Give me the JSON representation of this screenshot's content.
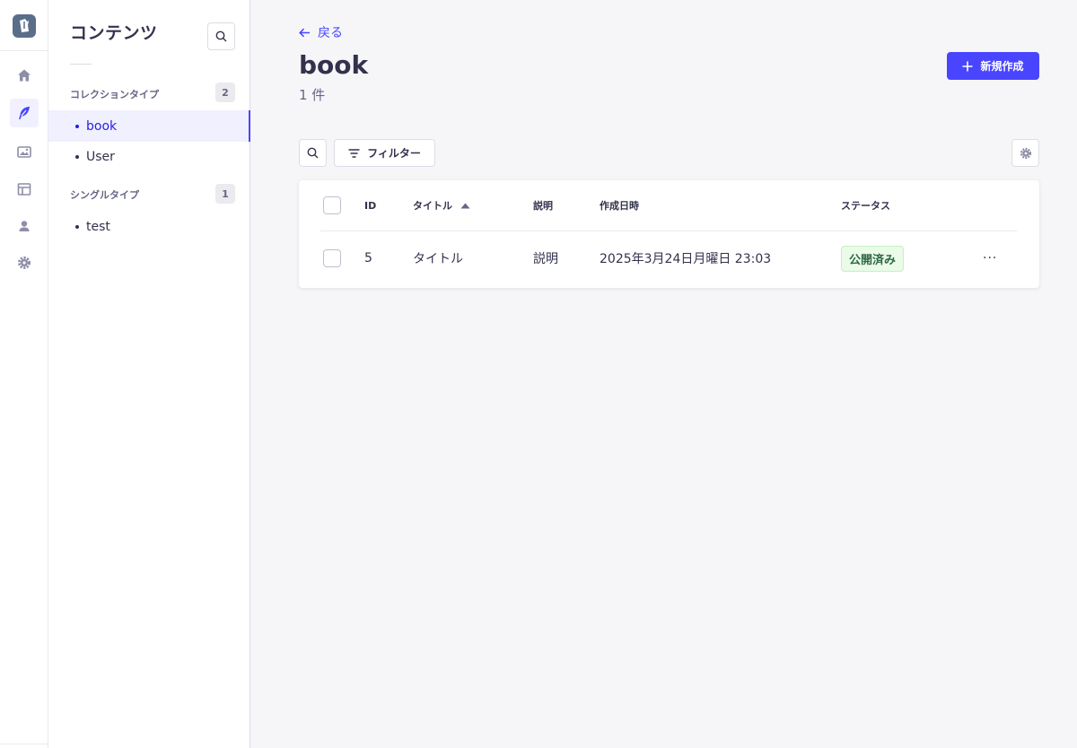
{
  "rail": {
    "items": [
      {
        "name": "home-icon"
      },
      {
        "name": "feather-icon",
        "active": true
      },
      {
        "name": "media-library-icon"
      },
      {
        "name": "layout-icon"
      },
      {
        "name": "user-icon"
      },
      {
        "name": "settings-icon"
      }
    ]
  },
  "subnav": {
    "title": "コンテンツ",
    "sections": [
      {
        "label": "コレクションタイプ",
        "count": "2",
        "items": [
          {
            "label": "book",
            "active": true
          },
          {
            "label": "User"
          }
        ]
      },
      {
        "label": "シングルタイプ",
        "count": "1",
        "items": [
          {
            "label": "test"
          }
        ]
      }
    ]
  },
  "header": {
    "back_label": "戻る",
    "title": "book",
    "subtitle": "1 件",
    "create_label": "新規作成"
  },
  "toolbar": {
    "filter_label": "フィルター"
  },
  "table": {
    "columns": [
      "ID",
      "タイトル",
      "説明",
      "作成日時",
      "ステータス"
    ],
    "sort_column": "タイトル",
    "rows": [
      {
        "id": "5",
        "title": "タイトル",
        "description": "説明",
        "created_at": "2025年3月24日月曜日 23:03",
        "status": "公開済み",
        "more": "···"
      }
    ]
  },
  "colors": {
    "primary": "#4945ff",
    "status_bg": "#eafbe7",
    "status_text": "#2f6846"
  }
}
